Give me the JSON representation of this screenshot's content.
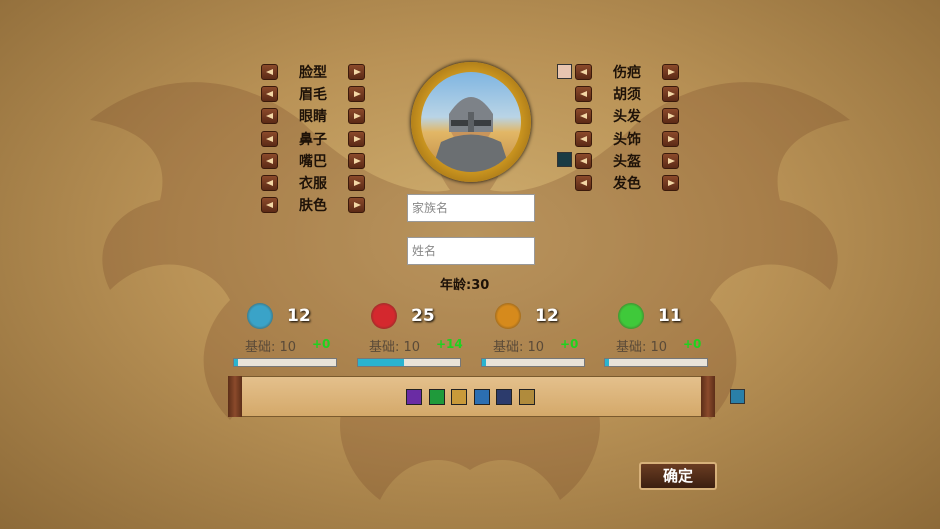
{
  "left_options": [
    "脸型",
    "眉毛",
    "眼睛",
    "鼻子",
    "嘴巴",
    "衣服",
    "肤色"
  ],
  "right_options": [
    "伤疤",
    "胡须",
    "头发",
    "头饰",
    "头盔",
    "发色"
  ],
  "family_name_placeholder": "家族名",
  "given_name_placeholder": "姓名",
  "age": "年龄:30",
  "stats": [
    {
      "icon": "diplomacy-icon",
      "value": "12",
      "base": "基础: 10",
      "bonus": "+0",
      "fill": 0.0,
      "color": "#3aa3c8"
    },
    {
      "icon": "martial-icon",
      "value": "25",
      "base": "基础: 10",
      "bonus": "+14",
      "fill": 0.45,
      "color": "#d4282e"
    },
    {
      "icon": "stewardship-icon",
      "value": "12",
      "base": "基础: 10",
      "bonus": "+0",
      "fill": 0.0,
      "color": "#d68a1c"
    },
    {
      "icon": "intrigue-icon",
      "value": "11",
      "base": "基础: 10",
      "bonus": "+0",
      "fill": 0.0,
      "color": "#3fc93a"
    }
  ],
  "traits": [
    {
      "name": "trait-purple-icon",
      "color": "#6a2ca4"
    },
    {
      "name": "trait-green-shield-icon",
      "color": "#1f9a3b"
    },
    {
      "name": "trait-gold-icon",
      "color": "#c99a3a"
    },
    {
      "name": "trait-blue-icon",
      "color": "#2c6fb2"
    },
    {
      "name": "trait-tower-icon",
      "color": "#2c3b6c"
    },
    {
      "name": "trait-scroll-icon",
      "color": "#b08b3c"
    }
  ],
  "confirm_label": "确定"
}
